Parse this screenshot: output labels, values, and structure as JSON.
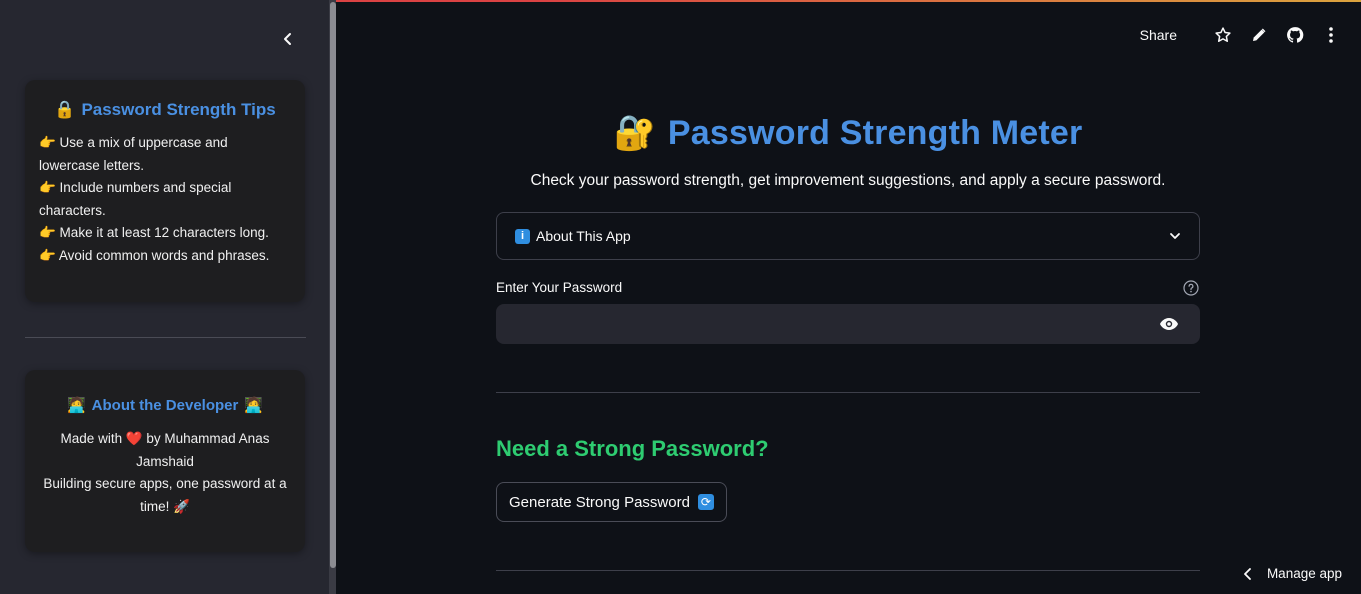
{
  "header": {
    "share_label": "Share",
    "icons": [
      "star-icon",
      "pencil-icon",
      "github-icon",
      "more-vertical-icon"
    ]
  },
  "sidebar": {
    "tips_card": {
      "emoji": "🔒",
      "title": "Password Strength Tips",
      "tips": [
        "👉 Use a mix of uppercase and lowercase letters.",
        "👉 Include numbers and special characters.",
        "👉 Make it at least 12 characters long.",
        "👉 Avoid common words and phrases."
      ]
    },
    "dev_card": {
      "emoji": "🧑‍💻",
      "title": "About the Developer",
      "line1": "Made with ❤️ by Muhammad Anas Jamshaid",
      "line2": "Building secure apps, one password at a time! 🚀"
    }
  },
  "main": {
    "title_emoji": "🔐",
    "title": "Password Strength Meter",
    "subtitle": "Check your password strength, get improvement suggestions, and apply a secure password.",
    "expander": {
      "badge": "i",
      "label": "About This App"
    },
    "password": {
      "label": "Enter Your Password",
      "value": "",
      "placeholder": ""
    },
    "generate_section": {
      "title": "Need a Strong Password?",
      "button_label": "Generate Strong Password",
      "button_badge": "🔄"
    }
  },
  "footer": {
    "manage_app_label": "Manage app"
  },
  "colors": {
    "accent_blue": "#4a90e2",
    "accent_green": "#2ecc71",
    "background": "#0e1117",
    "sidebar": "#262730"
  }
}
